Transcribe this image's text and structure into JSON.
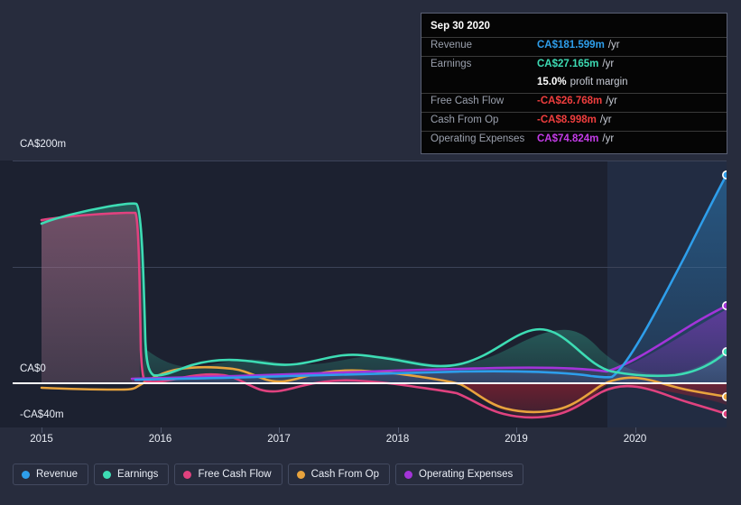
{
  "tooltip": {
    "date": "Sep 30 2020",
    "rows": [
      {
        "label": "Revenue",
        "value": "CA$181.599m",
        "suffix": "/yr",
        "color": "#2e9eeb"
      },
      {
        "label": "Earnings",
        "value": "CA$27.165m",
        "suffix": "/yr",
        "color": "#3ddcb4"
      },
      {
        "label": "",
        "value": "15.0%",
        "suffix": "profit margin",
        "color": "#ffffff"
      },
      {
        "label": "Free Cash Flow",
        "value": "-CA$26.768m",
        "suffix": "/yr",
        "color": "#f03e3e"
      },
      {
        "label": "Cash From Op",
        "value": "-CA$8.998m",
        "suffix": "/yr",
        "color": "#f03e3e"
      },
      {
        "label": "Operating Expenses",
        "value": "CA$74.824m",
        "suffix": "/yr",
        "color": "#c43ce8"
      }
    ]
  },
  "axes": {
    "y_labels": {
      "top": "CA$200m",
      "zero": "CA$0",
      "bottom": "-CA$40m"
    },
    "x_labels": [
      "2015",
      "2016",
      "2017",
      "2018",
      "2019",
      "2020"
    ]
  },
  "legend": [
    {
      "label": "Revenue",
      "color": "#2e9eeb"
    },
    {
      "label": "Earnings",
      "color": "#3ddcb4"
    },
    {
      "label": "Free Cash Flow",
      "color": "#e0427f"
    },
    {
      "label": "Cash From Op",
      "color": "#e8a33d"
    },
    {
      "label": "Operating Expenses",
      "color": "#a334d9"
    }
  ],
  "chart_data": {
    "type": "line",
    "title": "",
    "xlabel": "",
    "ylabel": "CA$",
    "ylim": [
      -40,
      200
    ],
    "grid": true,
    "legend_position": "bottom-left",
    "x_tick_labels": [
      "2015",
      "2016",
      "2017",
      "2018",
      "2019",
      "2020"
    ],
    "y_tick_labels": [
      "CA$200m",
      "CA$0",
      "-CA$40m"
    ],
    "x": [
      "2015.00",
      "2015.25",
      "2015.50",
      "2015.75",
      "2016.00",
      "2016.25",
      "2016.50",
      "2016.75",
      "2017.00",
      "2017.25",
      "2017.50",
      "2017.75",
      "2018.00",
      "2018.25",
      "2018.50",
      "2018.75",
      "2019.00",
      "2019.25",
      "2019.50",
      "2019.75",
      "2020.00",
      "2020.25",
      "2020.50",
      "2020.75"
    ],
    "series": [
      {
        "name": "Revenue",
        "color": "#2e9eeb",
        "values": [
          null,
          null,
          null,
          null,
          null,
          2,
          3,
          4,
          5,
          6,
          7,
          8,
          9,
          10,
          11,
          12,
          13,
          14,
          16,
          20,
          60,
          105,
          150,
          181.599
        ]
      },
      {
        "name": "Earnings",
        "color": "#3ddcb4",
        "values": [
          120,
          145,
          160,
          168,
          162,
          18,
          14,
          15,
          13,
          16,
          14,
          18,
          15,
          14,
          20,
          30,
          34,
          27,
          40,
          28,
          18,
          13,
          16,
          27.165
        ]
      },
      {
        "name": "Free Cash Flow",
        "color": "#e0427f",
        "values": [
          150,
          152,
          152,
          152,
          151,
          4,
          8,
          10,
          6,
          2,
          4,
          5,
          6,
          5,
          2,
          -2,
          -10,
          -16,
          -16,
          -6,
          -4,
          -8,
          -18,
          -26.768
        ]
      },
      {
        "name": "Cash From Op",
        "color": "#e8a33d",
        "values": [
          -5,
          -6,
          -7,
          -8,
          -7,
          6,
          10,
          13,
          10,
          6,
          8,
          9,
          10,
          9,
          6,
          1,
          -8,
          -14,
          -14,
          -2,
          2,
          -1,
          -5,
          -8.998
        ]
      },
      {
        "name": "Operating Expenses",
        "color": "#a334d9",
        "values": [
          null,
          null,
          null,
          null,
          2,
          3,
          4,
          5,
          6,
          6,
          7,
          8,
          9,
          10,
          11,
          12,
          13,
          14,
          16,
          20,
          34,
          48,
          62,
          74.824
        ]
      }
    ]
  }
}
